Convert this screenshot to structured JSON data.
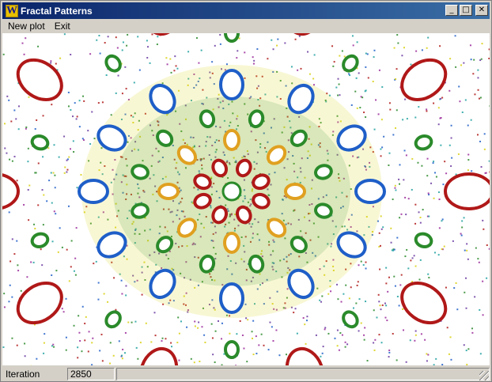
{
  "window": {
    "title": "Fractal Patterns",
    "icon": "w-logo-icon",
    "controls": {
      "minimize": "_",
      "maximize": "□",
      "close": "✕"
    }
  },
  "menu": {
    "items": [
      "New plot",
      "Exit"
    ]
  },
  "canvas": {
    "description_colors": {
      "ring_red": "#b01818",
      "ring_green": "#2a8a2a",
      "blue_cell": "#1e5ec8",
      "yellow": "#d8d010",
      "magenta": "#9a2a9a"
    }
  },
  "status": {
    "label": "Iteration",
    "value": "2850"
  }
}
